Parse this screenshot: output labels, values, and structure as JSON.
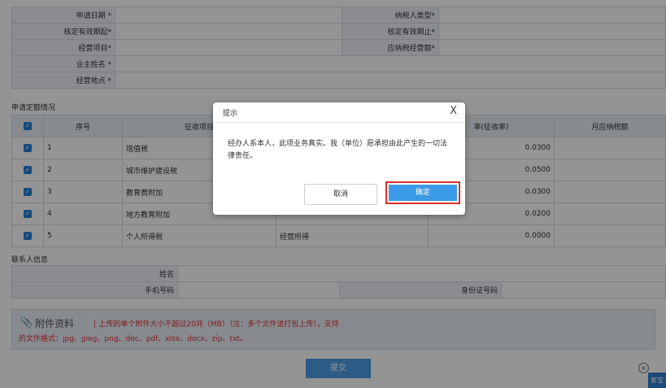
{
  "form": {
    "row1": {
      "left_label": "申请日期 *",
      "right_label": "纳税人类型*"
    },
    "row2": {
      "left_label": "核定有效期起*",
      "right_label": "核定有效期止*"
    },
    "row3": {
      "left_label": "经营项目*",
      "right_label": "应纳税经营额*"
    },
    "row4": {
      "left_label": "业主姓名 *"
    },
    "row5": {
      "left_label": "经营地点 *"
    }
  },
  "quota": {
    "section_title": "申请定额情况",
    "headers": {
      "check": "✓",
      "no": "序号",
      "item": "征收项目",
      "rate": "率(征收率)",
      "monthly": "月应纳税额"
    },
    "rows": [
      {
        "no": "1",
        "item": "增值税",
        "sub": "",
        "rate": "0.0300"
      },
      {
        "no": "2",
        "item": "城市维护建设税",
        "sub": "",
        "rate": "0.0500"
      },
      {
        "no": "3",
        "item": "教育费附加",
        "sub": "",
        "rate": "0.0300"
      },
      {
        "no": "4",
        "item": "地方教育附加",
        "sub": "",
        "rate": "0.0200"
      },
      {
        "no": "5",
        "item": "个人所得税",
        "sub": "经营所得",
        "rate": "0.0000"
      }
    ]
  },
  "contact": {
    "section_title": "联系人信息",
    "name_label": "姓名",
    "phone_label": "手机号码",
    "id_label": "身份证号码"
  },
  "attach": {
    "title": "附件资料",
    "note1": "[ 上传的单个附件大小不超过20兆（MB）（注：多个文件请打包上传），支持",
    "note2": "的文件格式：jpg、jpeg、png、doc、pdf、xlsx、docx、zip、txt。"
  },
  "submit_label": "提交",
  "dialog": {
    "title": "提示",
    "close": "X",
    "message": "经办人系本人，此项业务真实。我（单位）愿承担由此产生的一切法律责任。",
    "cancel_label": "取消",
    "ok_label": "确定"
  },
  "corner": {
    "close": "×",
    "badge": "客宝"
  },
  "colors": {
    "accent": "#3c9be8",
    "highlight": "#d9302b",
    "red_note": "#dd3333"
  }
}
